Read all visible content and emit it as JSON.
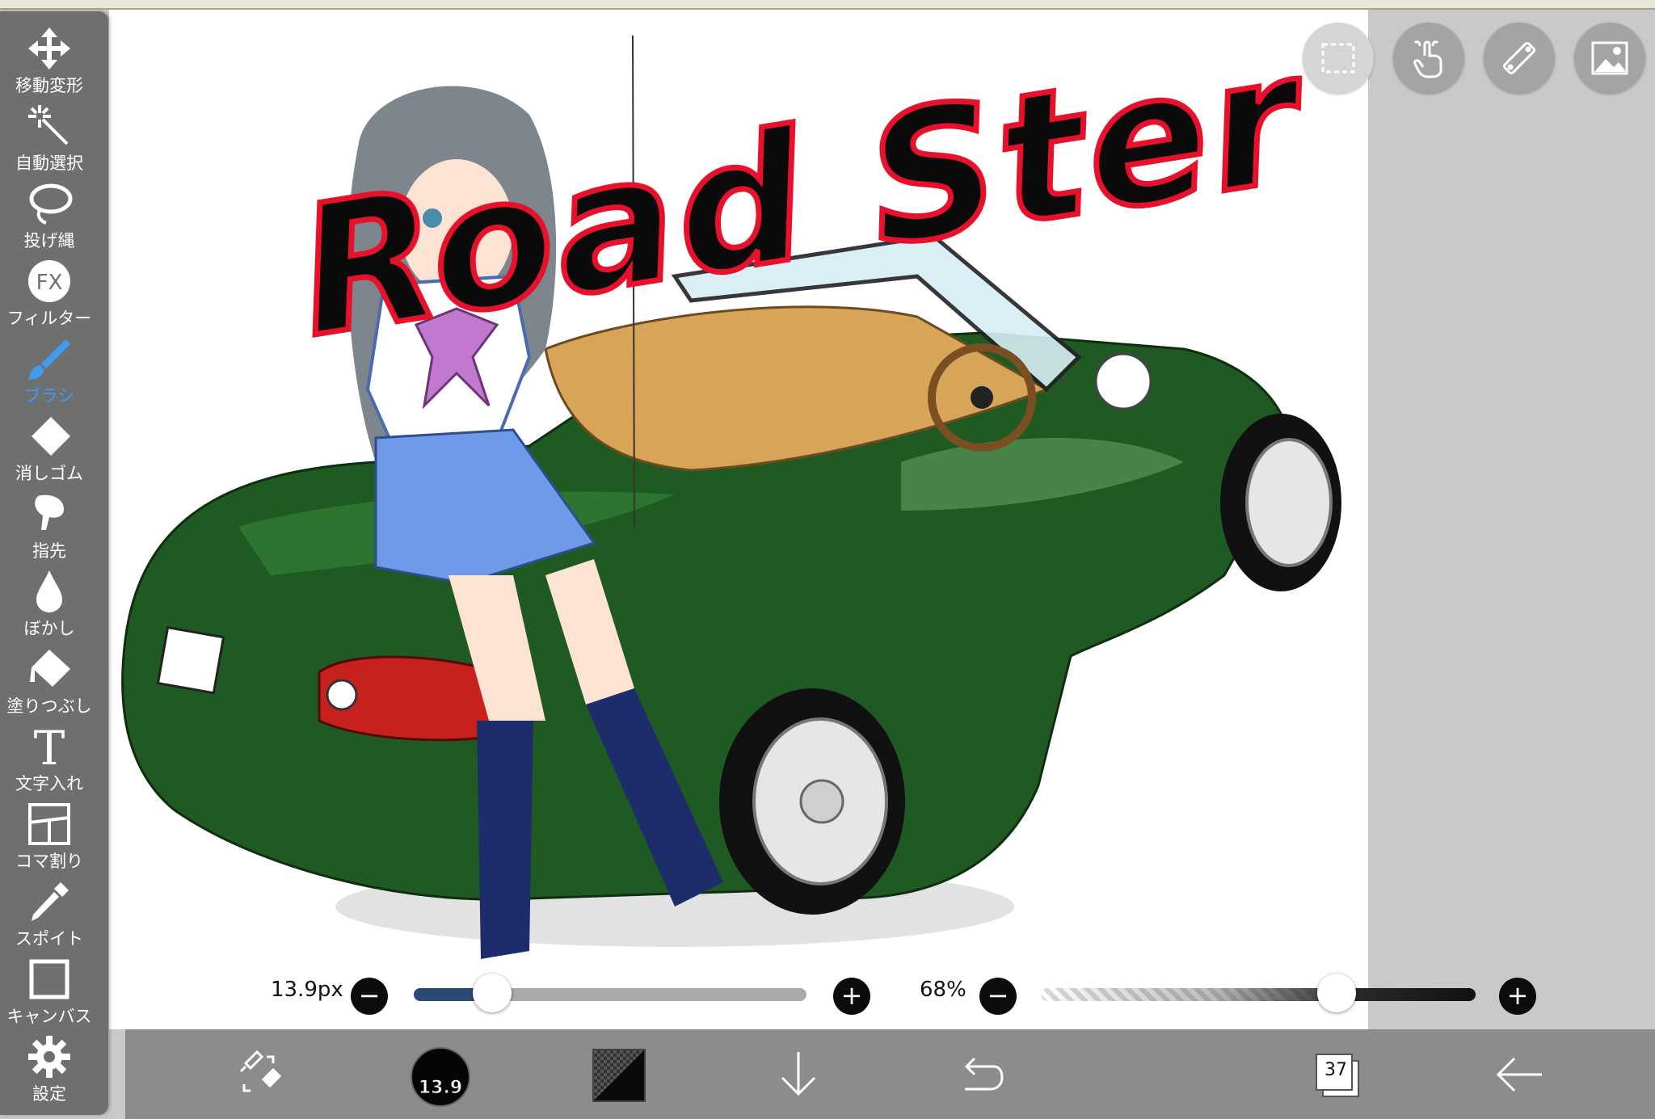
{
  "toolbar": {
    "tools": [
      {
        "label": "移動変形",
        "icon": "move-arrows-icon"
      },
      {
        "label": "自動選択",
        "icon": "magic-wand-icon"
      },
      {
        "label": "投げ縄",
        "icon": "lasso-icon"
      },
      {
        "label": "フィルター",
        "icon": "fx-filter-icon"
      },
      {
        "label": "ブラシ",
        "icon": "brush-icon",
        "active": true
      },
      {
        "label": "消しゴム",
        "icon": "eraser-icon"
      },
      {
        "label": "指先",
        "icon": "finger-smudge-icon"
      },
      {
        "label": "ぼかし",
        "icon": "blur-drop-icon"
      },
      {
        "label": "塗りつぶし",
        "icon": "bucket-fill-icon"
      },
      {
        "label": "文字入れ",
        "icon": "text-t-icon"
      },
      {
        "label": "コマ割り",
        "icon": "frame-divider-icon"
      },
      {
        "label": "スポイト",
        "icon": "eyedropper-icon"
      },
      {
        "label": "キャンバス",
        "icon": "canvas-square-icon"
      },
      {
        "label": "設定",
        "icon": "gear-icon"
      }
    ],
    "fx_glyph": "FX",
    "text_glyph": "T"
  },
  "top_buttons": [
    {
      "icon": "selection-rectangle-icon"
    },
    {
      "icon": "touch-hand-icon"
    },
    {
      "icon": "ruler-icon"
    },
    {
      "icon": "image-material-icon"
    }
  ],
  "canvas": {
    "artwork_title": "Road Ster"
  },
  "sliders": {
    "size": {
      "label": "13.9px",
      "value": 0.2
    },
    "opacity": {
      "label": "68%",
      "value": 0.68
    },
    "minus": "−",
    "plus": "+"
  },
  "bottom_bar": {
    "brush_size": "13.9",
    "layer_count": "37",
    "icons": [
      "brush-eraser-swap-icon",
      "brush-size-icon",
      "color-swatch-icon",
      "download-arrow-icon",
      "undo-icon",
      "layers-icon",
      "back-arrow-icon"
    ]
  },
  "colors": {
    "toolbar_bg": "#6f6f6f",
    "active_tool": "#3f9cf0",
    "bottom_bar_bg": "#8c8c8c",
    "size_fill": "#2b4a73",
    "title_fill": "#0a0a0a",
    "title_stroke": "#e8112b",
    "car_green": "#1f5a22"
  }
}
